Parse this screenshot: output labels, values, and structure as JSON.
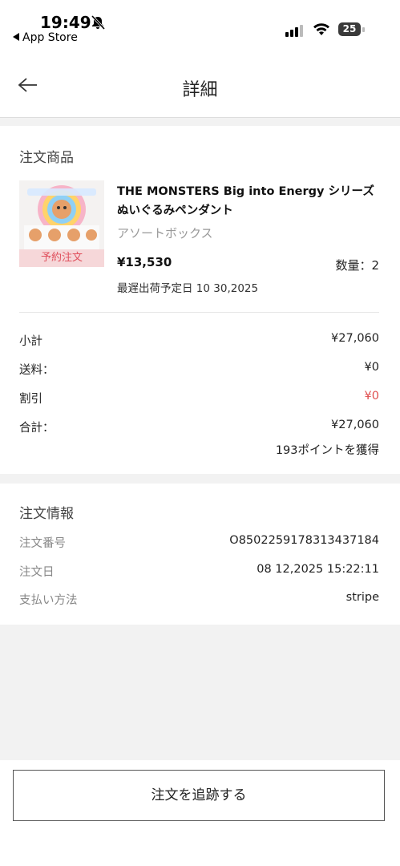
{
  "status_bar": {
    "time": "19:49",
    "back_app": "App Store",
    "battery": "25"
  },
  "nav": {
    "title": "詳細"
  },
  "order_items": {
    "section_title": "注文商品",
    "item": {
      "badge": "予約注文",
      "name": "THE MONSTERS Big into Energy シリーズ ぬいぐるみペンダント",
      "variant": "アソートボックス",
      "price": "¥13,530",
      "quantity": "数量：2",
      "ship_date": "最遅出荷予定日 10 30,2025"
    }
  },
  "summary": {
    "subtotal_label": "小計",
    "subtotal_value": "¥27,060",
    "shipping_label": "送料：",
    "shipping_value": "¥0",
    "discount_label": "割引",
    "discount_value": "¥0",
    "total_label": "合計：",
    "total_value": "¥27,060",
    "points": "193ポイントを獲得"
  },
  "order_info": {
    "section_title": "注文情報",
    "number_label": "注文番号",
    "number_value": "O8502259178313437184",
    "date_label": "注文日",
    "date_value": "08 12,2025 15:22:11",
    "payment_label": "支払い方法",
    "payment_value": "stripe"
  },
  "footer": {
    "track_button": "注文を追跡する"
  },
  "colors": {
    "accent_red": "#e05050",
    "badge_bg": "#f6d7d9"
  }
}
